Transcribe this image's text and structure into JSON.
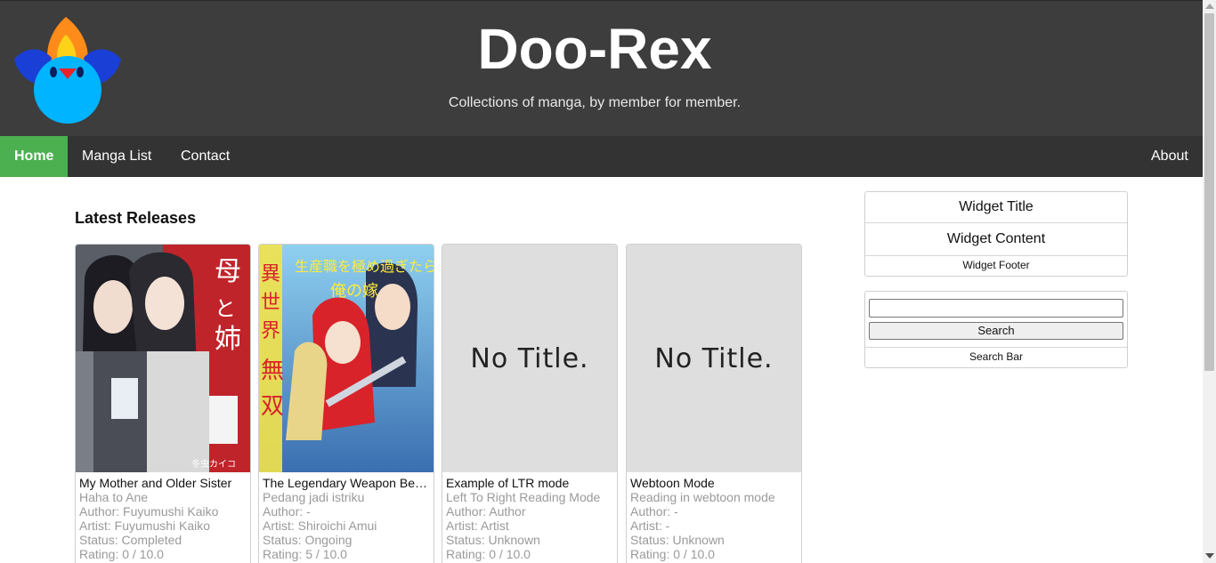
{
  "site": {
    "title": "Doo-Rex",
    "tagline": "Collections of manga, by member for member."
  },
  "nav": {
    "home": "Home",
    "manga_list": "Manga List",
    "contact": "Contact",
    "about": "About"
  },
  "main": {
    "section_title": "Latest Releases",
    "cards": [
      {
        "title": "My Mother and Older Sister",
        "alt_title": "Haha to Ane",
        "author": "Author: Fuyumushi Kaiko",
        "artist": "Artist: Fuyumushi Kaiko",
        "status": "Status: Completed",
        "rating": "Rating: 0 / 10.0",
        "cover": {
          "title_text": "母と姉",
          "author_text": "冬虫カイコ"
        }
      },
      {
        "title": "The Legendary Weapon Became My Bride",
        "alt_title": "Pedang jadi istriku",
        "author": "Author: -",
        "artist": "Artist: Shiroichi Amui",
        "status": "Status: Ongoing",
        "rating": "Rating: 5 / 10.0",
        "cover": {
          "title_text": "異世界無双"
        }
      },
      {
        "title": "Example of LTR mode",
        "alt_title": "Left To Right Reading Mode",
        "author": "Author: Author",
        "artist": "Artist: Artist",
        "status": "Status: Unknown",
        "rating": "Rating: 0 / 10.0",
        "cover": {
          "placeholder": "No Title."
        }
      },
      {
        "title": "Webtoon Mode",
        "alt_title": "Reading in webtoon mode",
        "author": "Author: -",
        "artist": "Artist: -",
        "status": "Status: Unknown",
        "rating": "Rating: 0 / 10.0",
        "cover": {
          "placeholder": "No Title."
        }
      }
    ]
  },
  "sidebar": {
    "widget": {
      "title": "Widget Title",
      "content": "Widget Content",
      "footer": "Widget Footer"
    },
    "search": {
      "input_value": "",
      "button_label": "Search",
      "footer": "Search Bar"
    }
  },
  "colors": {
    "header_bg": "#3d3d3d",
    "nav_bg": "#333333",
    "nav_active": "#4caf50"
  }
}
